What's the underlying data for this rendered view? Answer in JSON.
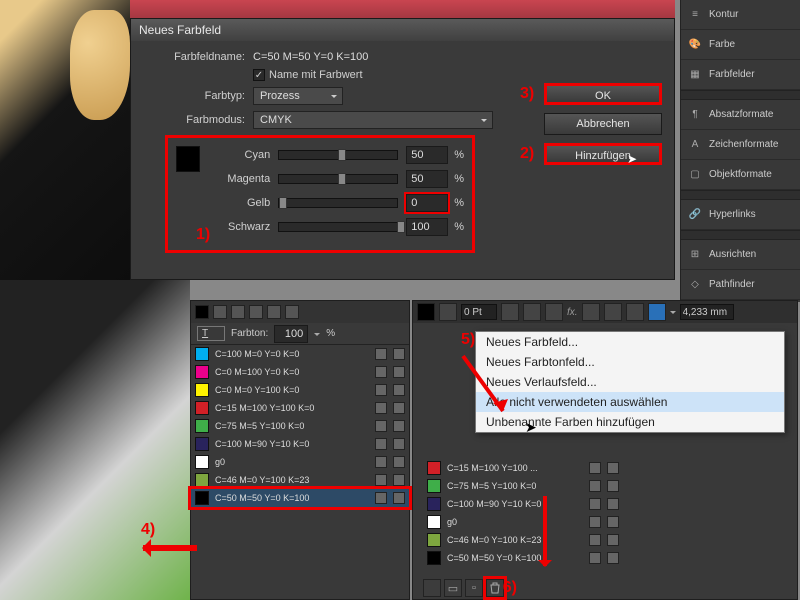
{
  "dialog": {
    "title": "Neues Farbfeld",
    "name_label": "Farbfeldname:",
    "name_value": "C=50 M=50 Y=0 K=100",
    "name_with_value_label": "Name mit Farbwert",
    "type_label": "Farbtyp:",
    "type_value": "Prozess",
    "mode_label": "Farbmodus:",
    "mode_value": "CMYK",
    "sliders": [
      {
        "label": "Cyan",
        "value": "50",
        "pos": 50
      },
      {
        "label": "Magenta",
        "value": "50",
        "pos": 50
      },
      {
        "label": "Gelb",
        "value": "0",
        "pos": 0
      },
      {
        "label": "Schwarz",
        "value": "100",
        "pos": 100
      }
    ],
    "pct": "%",
    "ok": "OK",
    "cancel": "Abbrechen",
    "add": "Hinzufügen"
  },
  "annotations": {
    "n1": "1)",
    "n2": "2)",
    "n3": "3)",
    "n4": "4)",
    "n5": "5)",
    "n6": "6)"
  },
  "right_panels": [
    "Kontur",
    "Farbe",
    "Farbfelder",
    "",
    "Absatzformate",
    "Zeichenformate",
    "Objektformate",
    "",
    "Hyperlinks",
    "",
    "Ausrichten",
    "Pathfinder"
  ],
  "swatches_header": {
    "tint_label": "Farbton:",
    "tint_value": "100",
    "pct": "%",
    "tip_label": "T"
  },
  "swatch_list": [
    {
      "name": "C=100 M=0 Y=0 K=0",
      "color": "#00aeef"
    },
    {
      "name": "C=0 M=100 Y=0 K=0",
      "color": "#ec008c"
    },
    {
      "name": "C=0 M=0 Y=100 K=0",
      "color": "#fff200"
    },
    {
      "name": "C=15 M=100 Y=100 K=0",
      "color": "#d22027"
    },
    {
      "name": "C=75 M=5 Y=100 K=0",
      "color": "#3fae49"
    },
    {
      "name": "C=100 M=90 Y=10 K=0",
      "color": "#29235c"
    },
    {
      "name": "g0",
      "color": "#ffffff"
    },
    {
      "name": "C=46 M=0 Y=100 K=23",
      "color": "#7ea63f"
    },
    {
      "name": "C=50 M=50 Y=0 K=100",
      "color": "#000000"
    }
  ],
  "swatch_list2": [
    {
      "name": "C=15 M=100 Y=100 ...",
      "color": "#d22027"
    },
    {
      "name": "C=75 M=5 Y=100 K=0",
      "color": "#3fae49"
    },
    {
      "name": "C=100 M=90 Y=10 K=0",
      "color": "#29235c"
    },
    {
      "name": "g0",
      "color": "#ffffff"
    },
    {
      "name": "C=46 M=0 Y=100 K=23",
      "color": "#7ea63f"
    },
    {
      "name": "C=50 M=50 Y=0 K=100",
      "color": "#000000"
    }
  ],
  "context_menu": [
    "Neues Farbfeld...",
    "Neues Farbtonfeld...",
    "Neues Verlaufsfeld...",
    "Alle nicht verwendeten auswählen",
    "Unbenannte Farben hinzufügen"
  ],
  "toolbar2": {
    "pt_value": "0 Pt",
    "mm_value": "4,233 mm",
    "fx": "fx."
  }
}
